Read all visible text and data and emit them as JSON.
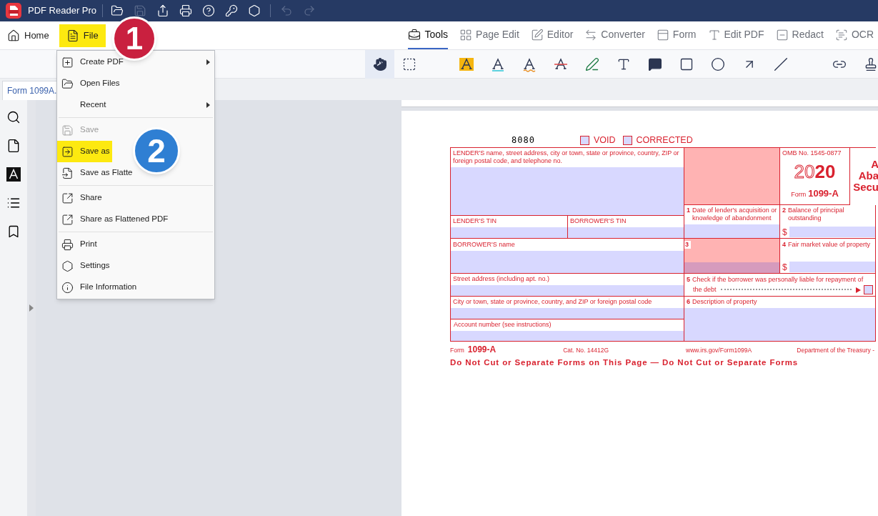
{
  "app": {
    "title": "PDF Reader Pro"
  },
  "quick_actions": [
    {
      "disabled": false
    },
    {
      "disabled": true
    },
    {
      "disabled": false
    },
    {
      "disabled": false
    },
    {
      "disabled": false
    },
    {
      "disabled": false
    },
    {
      "disabled": false
    },
    {
      "disabled": true
    },
    {
      "disabled": true
    }
  ],
  "left_nav": [
    {
      "label": "Home",
      "highlighted": false
    },
    {
      "label": "File",
      "highlighted": true
    }
  ],
  "nav_tabs": [
    {
      "label": "Tools",
      "selected": true
    },
    {
      "label": "Page Edit",
      "selected": false
    },
    {
      "label": "Editor",
      "selected": false
    },
    {
      "label": "Converter",
      "selected": false
    },
    {
      "label": "Form",
      "selected": false
    },
    {
      "label": "Edit PDF",
      "selected": false
    },
    {
      "label": "Redact",
      "selected": false
    },
    {
      "label": "OCR",
      "selected": false
    }
  ],
  "tools": [
    {
      "kind": "tool",
      "selected": true
    },
    {
      "kind": "tool",
      "selected": false
    },
    {
      "kind": "separator"
    },
    {
      "kind": "tool",
      "selected": false
    },
    {
      "kind": "tool",
      "selected": false
    },
    {
      "kind": "tool",
      "selected": false
    },
    {
      "kind": "tool",
      "selected": false
    },
    {
      "kind": "tool",
      "selected": false
    },
    {
      "kind": "tool",
      "selected": false
    },
    {
      "kind": "tool",
      "selected": false
    },
    {
      "kind": "tool",
      "selected": false
    },
    {
      "kind": "tool",
      "selected": false
    },
    {
      "kind": "tool",
      "selected": false
    },
    {
      "kind": "tool",
      "selected": false
    },
    {
      "kind": "separator"
    },
    {
      "kind": "tool",
      "selected": false
    },
    {
      "kind": "tool",
      "selected": false
    }
  ],
  "document_tab": {
    "label": "Form 1099A.",
    "selected": true
  },
  "menu": {
    "items": [
      {
        "kind": "item",
        "label": "Create PDF",
        "submenu": true,
        "disabled": false,
        "highlighted": false
      },
      {
        "kind": "item",
        "label": "Open Files",
        "submenu": false,
        "disabled": false,
        "highlighted": false
      },
      {
        "kind": "item",
        "label": "Recent",
        "submenu": true,
        "disabled": false,
        "highlighted": false
      },
      {
        "kind": "separator"
      },
      {
        "kind": "item",
        "label": "Save",
        "submenu": false,
        "disabled": true,
        "highlighted": false
      },
      {
        "kind": "item",
        "label": "Save as",
        "submenu": false,
        "disabled": false,
        "highlighted": true
      },
      {
        "kind": "item",
        "label": "Save as Flatte",
        "submenu": false,
        "disabled": false,
        "highlighted": false
      },
      {
        "kind": "separator"
      },
      {
        "kind": "item",
        "label": "Share",
        "submenu": false,
        "disabled": false,
        "highlighted": false
      },
      {
        "kind": "item",
        "label": "Share as Flattened PDF",
        "submenu": false,
        "disabled": false,
        "highlighted": false
      },
      {
        "kind": "separator"
      },
      {
        "kind": "item",
        "label": "Print",
        "submenu": false,
        "disabled": false,
        "highlighted": false
      },
      {
        "kind": "item",
        "label": "Settings",
        "submenu": false,
        "disabled": false,
        "highlighted": false
      },
      {
        "kind": "item",
        "label": "File Information",
        "submenu": false,
        "disabled": false,
        "highlighted": false
      }
    ]
  },
  "callouts": [
    {
      "label": "1",
      "color": "#c9203f"
    },
    {
      "label": "2",
      "color": "#2f7fd3"
    }
  ],
  "form": {
    "code": "8080",
    "checkboxes": [
      {
        "label": "VOID",
        "checked": false
      },
      {
        "label": "CORRECTED",
        "checked": false
      }
    ],
    "lender": "LENDER'S name, street address, city or town, state or province, country, ZIP or foreign postal code, and telephone no.",
    "omb": "OMB No. 1545-0877",
    "year_outline": "20",
    "year_bold": "20",
    "form_label": "Form",
    "form_number": "1099-A",
    "title_lines": [
      "A",
      "Aba",
      "Secu"
    ],
    "box1": {
      "number": "1",
      "label": "Date of lender's acquisition or knowledge of abandonment"
    },
    "box2": {
      "number": "2",
      "label": "Balance of principal outstanding",
      "currency": "$"
    },
    "lender_tin": "LENDER'S TIN",
    "borrower_tin": "BORROWER'S TIN",
    "borrower_name": "BORROWER'S name",
    "box3": {
      "number": "3"
    },
    "box4": {
      "number": "4",
      "label": "Fair market value of property",
      "currency": "$"
    },
    "street": "Street address (including apt. no.)",
    "box5": {
      "number": "5",
      "lines": [
        "Check if the borrower was personally liable for repayment of",
        "the debt"
      ],
      "checked": false
    },
    "city": "City or town, state or province, country, and ZIP or foreign postal code",
    "box6": {
      "number": "6",
      "label": "Description of property"
    },
    "account": "Account number (see instructions)",
    "footer": {
      "form_label": "Form",
      "form_number": "1099-A",
      "cat": "Cat. No. 14412G",
      "url": "www.irs.gov/Form1099A",
      "dept": "Department of the Treasury -"
    },
    "notice": "Do Not Cut or Separate Forms on This Page — Do Not Cut or Separate Forms"
  }
}
